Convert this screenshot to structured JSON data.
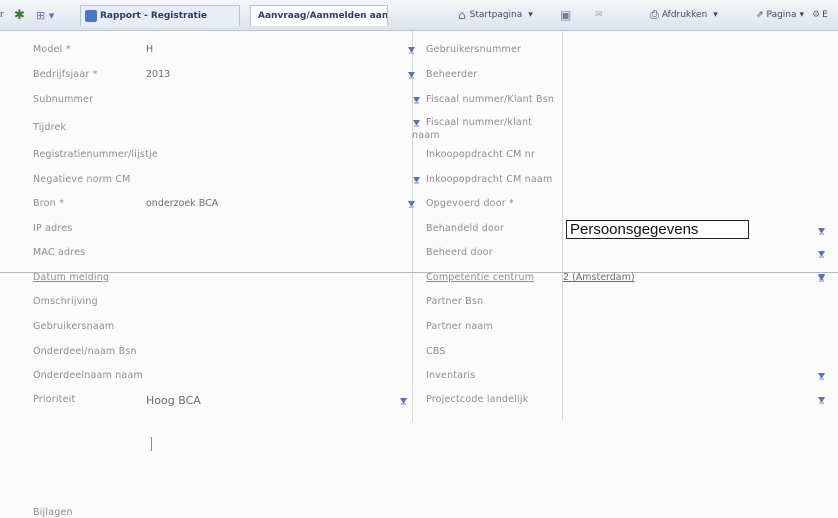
{
  "toolbar": {
    "tab1": "Rapport - Registratie",
    "tab2": "Aanvraag/Aanmelden aan... ×",
    "startpagina": "Startpagina",
    "afdrukken": "Afdrukken",
    "pagina": "Pagina",
    "extra": "E"
  },
  "left": {
    "model": {
      "label": "Model *",
      "value": "H"
    },
    "bedrijfsjaar": {
      "label": "Bedrijfsjaar *",
      "value": "2013"
    },
    "subnummer": {
      "label": "Subnummer"
    },
    "tijdrek": {
      "label": "Tijdrek"
    },
    "registratienummer": {
      "label": "Registratienummer/lijstje"
    },
    "negatief": {
      "label": "Negatieve norm CM"
    },
    "bron": {
      "label": "Bron *",
      "value": "onderzoek BCA"
    },
    "ipadres": {
      "label": "IP adres"
    },
    "macadres": {
      "label": "MAC adres"
    },
    "datum": {
      "label": "Datum melding"
    },
    "omschrijving": {
      "label": "Omschrijving"
    },
    "gebruikersnaam": {
      "label": "Gebruikersnaam"
    },
    "onderdeel_bsn": {
      "label": "Onderdeel/naam Bsn"
    },
    "onderdeel_naam": {
      "label": "Onderdeelnaam naam"
    },
    "prioriteit": {
      "label": "Prioriteit",
      "value": "Hoog BCA"
    },
    "bijlagen": {
      "label": "Bijlagen"
    }
  },
  "right": {
    "gebruiker": {
      "label": "Gebruikersnummer"
    },
    "beheerder": {
      "label": "Beheerder"
    },
    "fiscaal_nummer": {
      "label": "Fiscaal nummer/Klant Bsn"
    },
    "fiscaal_naam": {
      "label_line1": "Fiscaal nummer/klant",
      "label_line2": "naam"
    },
    "inkoop_cm": {
      "label": "Inkoopopdracht CM nr"
    },
    "inkoop_naam": {
      "label": "Inkoopopdracht CM naam"
    },
    "opgevoerd": {
      "label": "Opgevoerd door *",
      "value": "Persoonsgegevens"
    },
    "behandeld": {
      "label": "Behandeld door"
    },
    "beheerd": {
      "label": "Beheerd door"
    },
    "competentie": {
      "label": "Competentie centrum",
      "value": "2 (Amsterdam)"
    },
    "partner_bsn": {
      "label": "Partner Bsn"
    },
    "partner_naam": {
      "label": "Partner naam"
    },
    "cbs": {
      "label": "CBS"
    },
    "inventaris": {
      "label": "Inventaris"
    },
    "projectcode": {
      "label": "Projectcode landelijk"
    }
  },
  "colors": {
    "dropdown": "#5a74b8",
    "toolbar": "#dde3ec"
  }
}
